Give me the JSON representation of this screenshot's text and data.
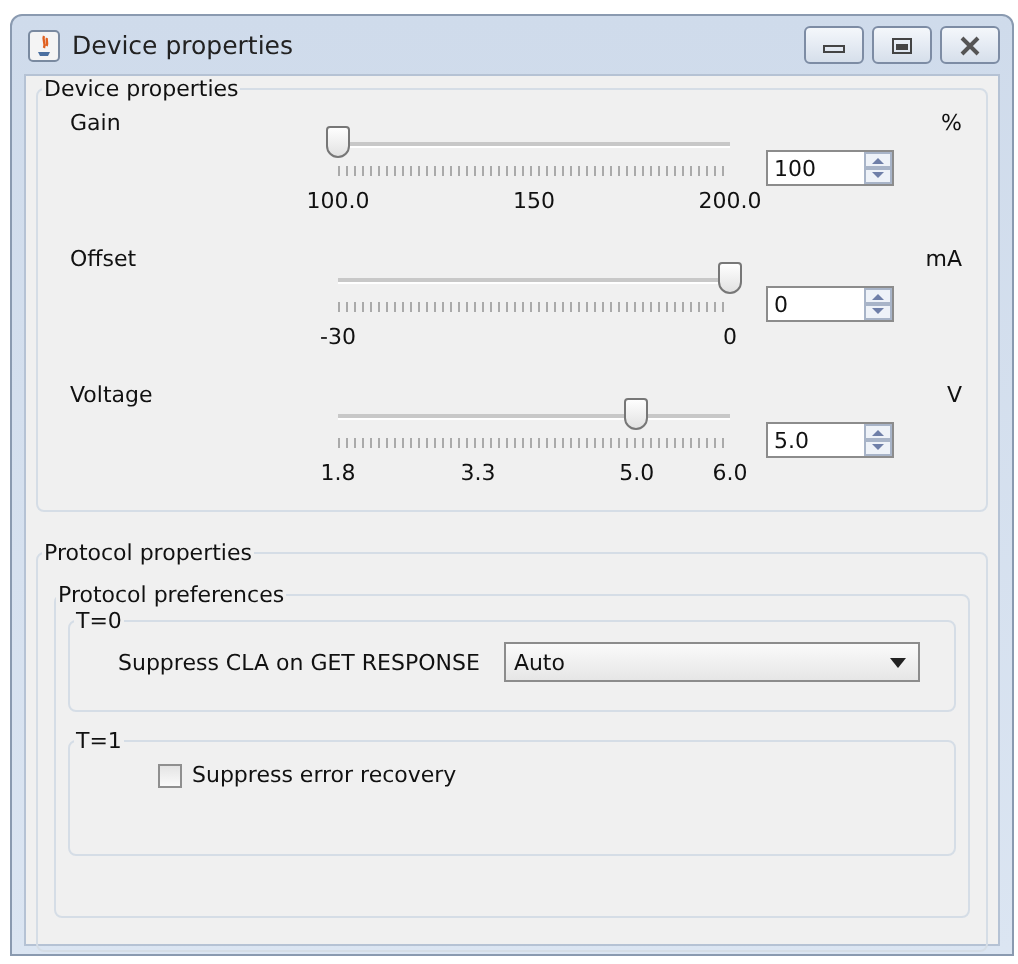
{
  "window": {
    "title": "Device properties"
  },
  "device_properties": {
    "title": "Device properties",
    "sliders": [
      {
        "label": "Gain",
        "unit": "%",
        "level": 0,
        "value": "100",
        "ticks": [
          "100.0",
          "150",
          "200.0"
        ]
      },
      {
        "label": "Offset",
        "unit": "mA",
        "level": 1,
        "value": "0",
        "ticks": [
          "-30",
          "0"
        ]
      },
      {
        "label": "Voltage",
        "unit": "V",
        "level": 0.762,
        "value": "5.0",
        "ticks": [
          "1.8",
          "3.3",
          "5.0",
          "6.0"
        ]
      }
    ]
  },
  "protocol_properties": {
    "title": "Protocol properties",
    "preferences": {
      "title": "Protocol preferences",
      "t0": {
        "title": "T=0",
        "label": "Suppress CLA on GET RESPONSE",
        "value": "Auto"
      },
      "t1": {
        "title": "T=1",
        "checkbox": {
          "label": "Suppress error recovery",
          "checked": false
        }
      }
    }
  }
}
